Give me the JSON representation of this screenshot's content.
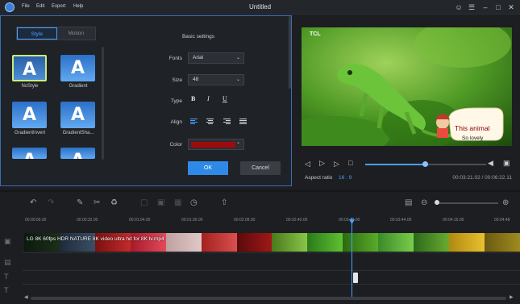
{
  "app": {
    "title": "Untitled",
    "menu": [
      "File",
      "Edit",
      "Export",
      "Help"
    ]
  },
  "style_panel": {
    "tabs": [
      {
        "label": "Style"
      },
      {
        "label": "Motion"
      }
    ],
    "tile_letter": "A",
    "styles": [
      {
        "label": "NoStyle"
      },
      {
        "label": "Gradient"
      },
      {
        "label": "GradientInvert"
      },
      {
        "label": "GradientSha..."
      },
      {
        "label": ""
      },
      {
        "label": ""
      }
    ],
    "selected": "NoStyle"
  },
  "settings": {
    "title": "Basic settings",
    "fonts_label": "Fonts",
    "font_value": "Arial",
    "size_label": "Size",
    "size_value": "48",
    "type_label": "Type",
    "type_bold": "B",
    "type_italic": "I",
    "type_underline": "U",
    "align_label": "Align",
    "color_label": "Color",
    "color_value": "#9e0b0b",
    "ok": "OK",
    "cancel": "Cancel"
  },
  "preview": {
    "watermark": "TCL",
    "caption_line1": "This animal",
    "caption_line2": "So lovely",
    "aspect_label": "Aspect ratio",
    "aspect_value": "16 : 9",
    "timecode": "00:03:21.02 / 00:06:22.11",
    "progress": 0.49
  },
  "timeline": {
    "ticks": [
      "00:00:00.00",
      "00:00:32.00",
      "00:01:04.00",
      "00:01:36.00",
      "00:02:08.00",
      "00:02:40.00",
      "00:03:12.00",
      "00:03:44.00",
      "00:04:16.00",
      "00:04:48"
    ],
    "clip_label": "LG 8K 60fps HDR NATURE 8K video ultra hd for 8K tv.mp4",
    "accent": "#4aa0ff"
  }
}
